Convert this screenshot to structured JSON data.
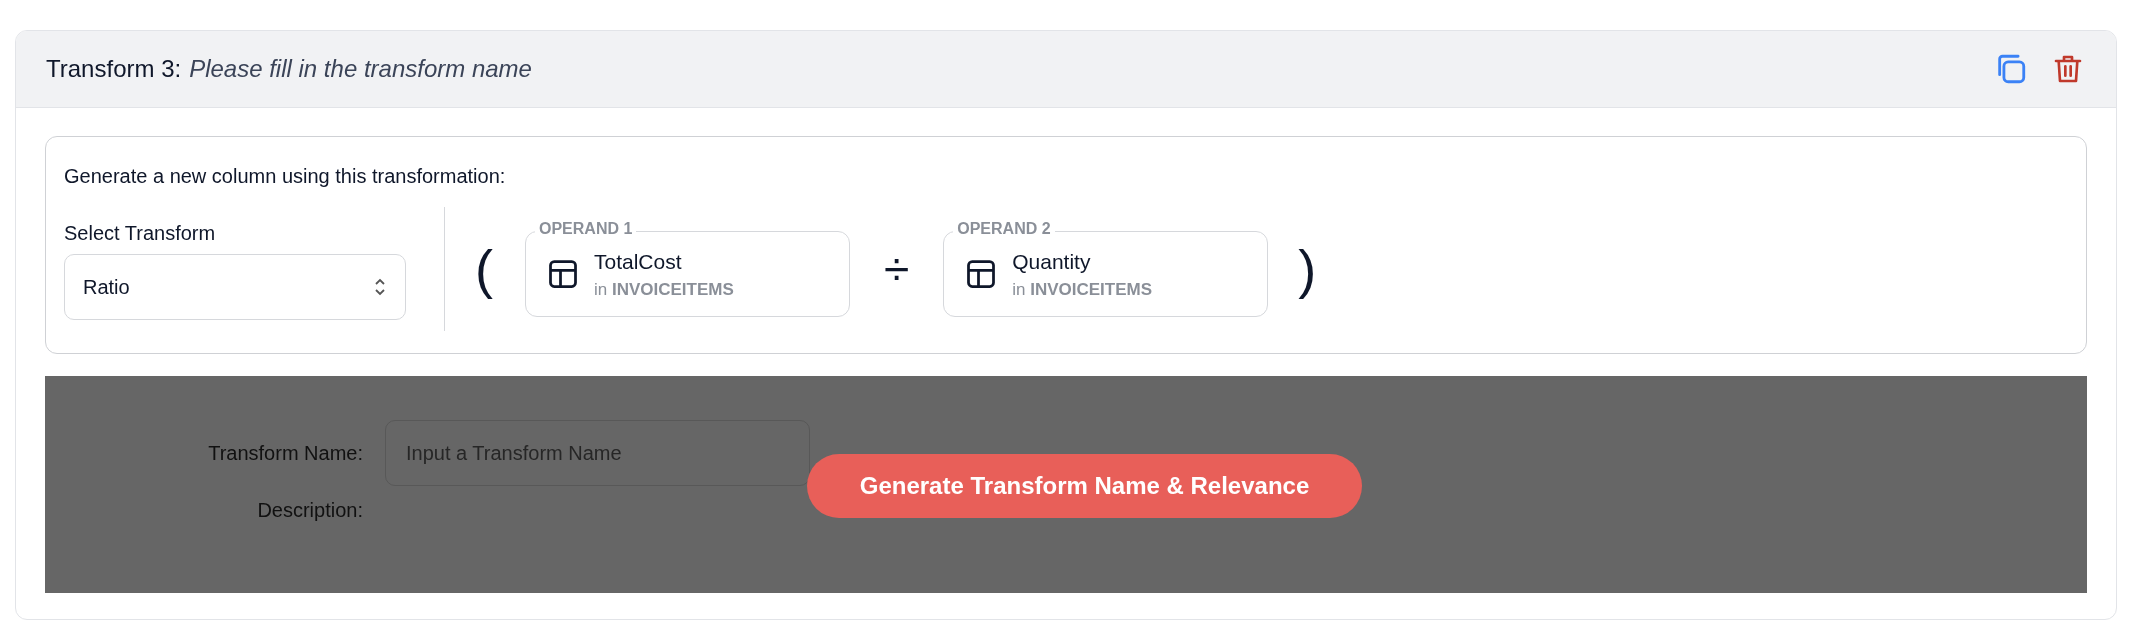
{
  "header": {
    "title": "Transform 3:",
    "subtitle": "Please fill in the transform name"
  },
  "builder": {
    "heading": "Generate a new column using this transformation:",
    "select_label": "Select Transform",
    "select_value": "Ratio",
    "open_paren": "(",
    "operator": "÷",
    "close_paren": ")",
    "operands": [
      {
        "legend": "OPERAND 1",
        "column": "TotalCost",
        "prefix": "in",
        "table": "INVOICEITEMS"
      },
      {
        "legend": "OPERAND 2",
        "column": "Quantity",
        "prefix": "in",
        "table": "INVOICEITEMS"
      }
    ]
  },
  "naming": {
    "fields": [
      {
        "kind": "input",
        "label": "Transform Name:",
        "placeholder": "Input a Transform Name"
      },
      {
        "kind": "text",
        "label": "Description:"
      }
    ],
    "generate_button": "Generate Transform Name & Relevance"
  }
}
